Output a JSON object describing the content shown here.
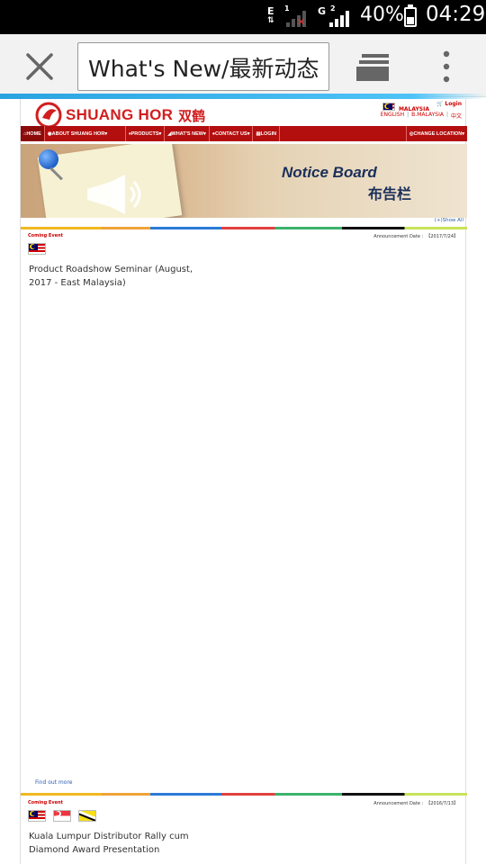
{
  "status_bar": {
    "network_1": "E",
    "network_2": "G",
    "sim_1": "1",
    "sim_2": "2",
    "battery_percent": "40%",
    "time": "04:29"
  },
  "browser": {
    "url_text": "What's New/最新动态",
    "icons": [
      "close-icon",
      "tabs-icon",
      "overflow-menu-icon"
    ]
  },
  "site": {
    "logo_text": "SHUANG HOR",
    "logo_cn": "双鹤",
    "country": "MALAYSIA",
    "login": "Login",
    "languages": [
      "ENGLISH",
      "B.MALAYSIA",
      "中文"
    ],
    "nav": [
      "HOME",
      "ABOUT SHUANG HOR",
      "PRODUCTS",
      "WHAT'S NEW",
      "CONTACT US",
      "LOGIN",
      "CHANGE LOCATION"
    ],
    "banner_title_en": "Notice Board",
    "banner_title_cn": "布告栏",
    "show_all": "(+)Show All"
  },
  "entries": [
    {
      "tag": "Coming Event",
      "date_label": "Announcement Date :",
      "date": "【2017/7/24】",
      "flags": [
        "malaysia"
      ],
      "title": "Product Roadshow Seminar (August, 2017 - East Malaysia)",
      "link": "Find out more"
    },
    {
      "tag": "Coming Event",
      "date_label": "Announcement Date :",
      "date": "【2016/7/13】",
      "flags": [
        "malaysia",
        "singapore",
        "brunei"
      ],
      "title": "Kuala Lumpur Distributor Rally cum Diamond Award Presentation"
    }
  ]
}
